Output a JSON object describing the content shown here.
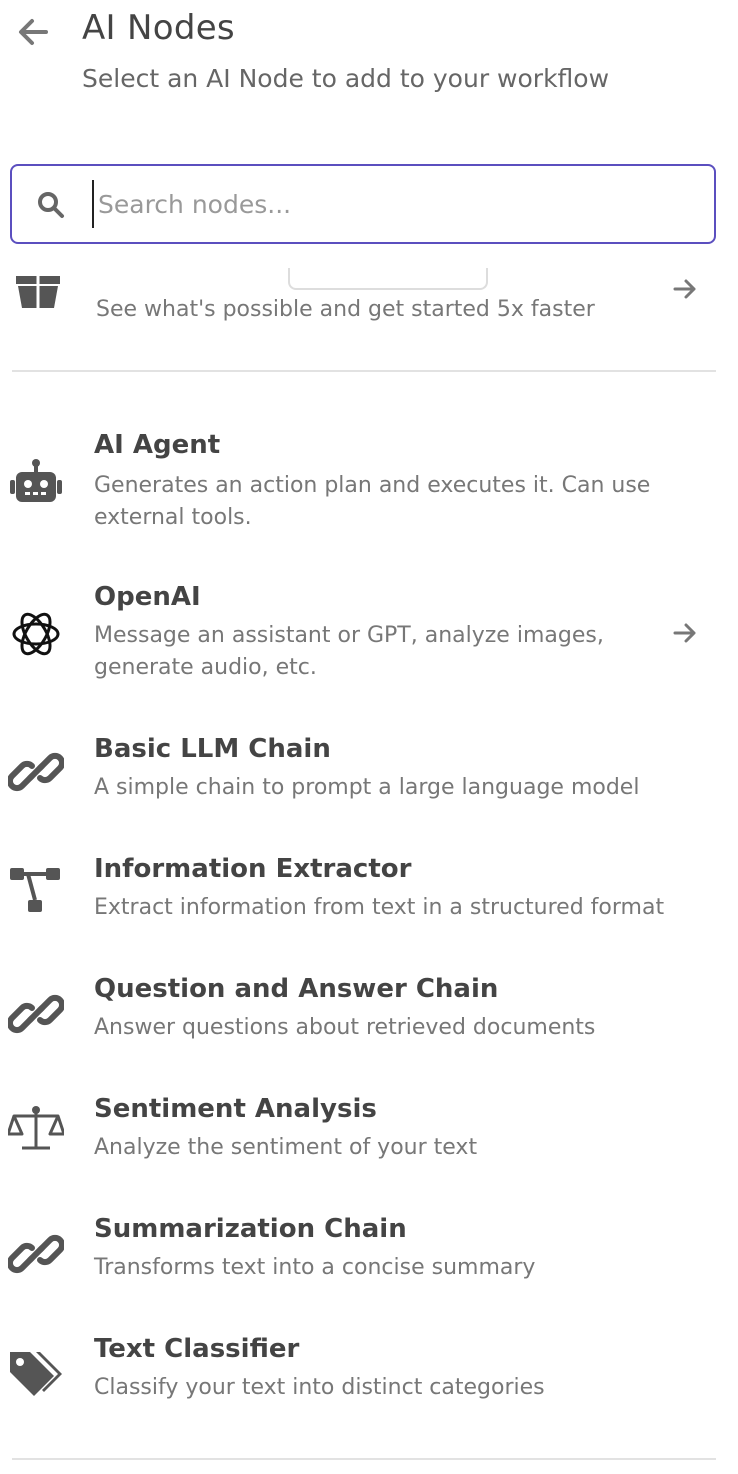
{
  "header": {
    "title": "AI Nodes",
    "subtitle": "Select an AI Node to add to your workflow",
    "back_icon": "arrow-left-icon"
  },
  "search": {
    "placeholder": "Search nodes...",
    "value": "",
    "icon": "search-icon"
  },
  "partial_item": {
    "description": "See what's possible and get started 5x faster",
    "icon": "gift-box-icon"
  },
  "nodes": [
    {
      "name": "AI Agent",
      "description": "Generates an action plan and executes it. Can use external tools.",
      "icon": "robot-icon"
    },
    {
      "name": "OpenAI",
      "description": "Message an assistant or GPT, analyze images, generate audio, etc.",
      "icon": "openai-icon"
    },
    {
      "name": "Basic LLM Chain",
      "description": "A simple chain to prompt a large language model",
      "icon": "link-icon"
    },
    {
      "name": "Information Extractor",
      "description": "Extract information from text in a structured format",
      "icon": "hierarchy-icon"
    },
    {
      "name": "Question and Answer Chain",
      "description": "Answer questions about retrieved documents",
      "icon": "link-icon"
    },
    {
      "name": "Sentiment Analysis",
      "description": "Analyze the sentiment of your text",
      "icon": "balance-scale-icon"
    },
    {
      "name": "Summarization Chain",
      "description": "Transforms text into a concise summary",
      "icon": "link-icon"
    },
    {
      "name": "Text Classifier",
      "description": "Classify your text into distinct categories",
      "icon": "tags-icon"
    }
  ],
  "colors": {
    "accent": "#5b4fbf",
    "icon": "#555555",
    "text_primary": "#444444",
    "text_secondary": "#777777"
  }
}
